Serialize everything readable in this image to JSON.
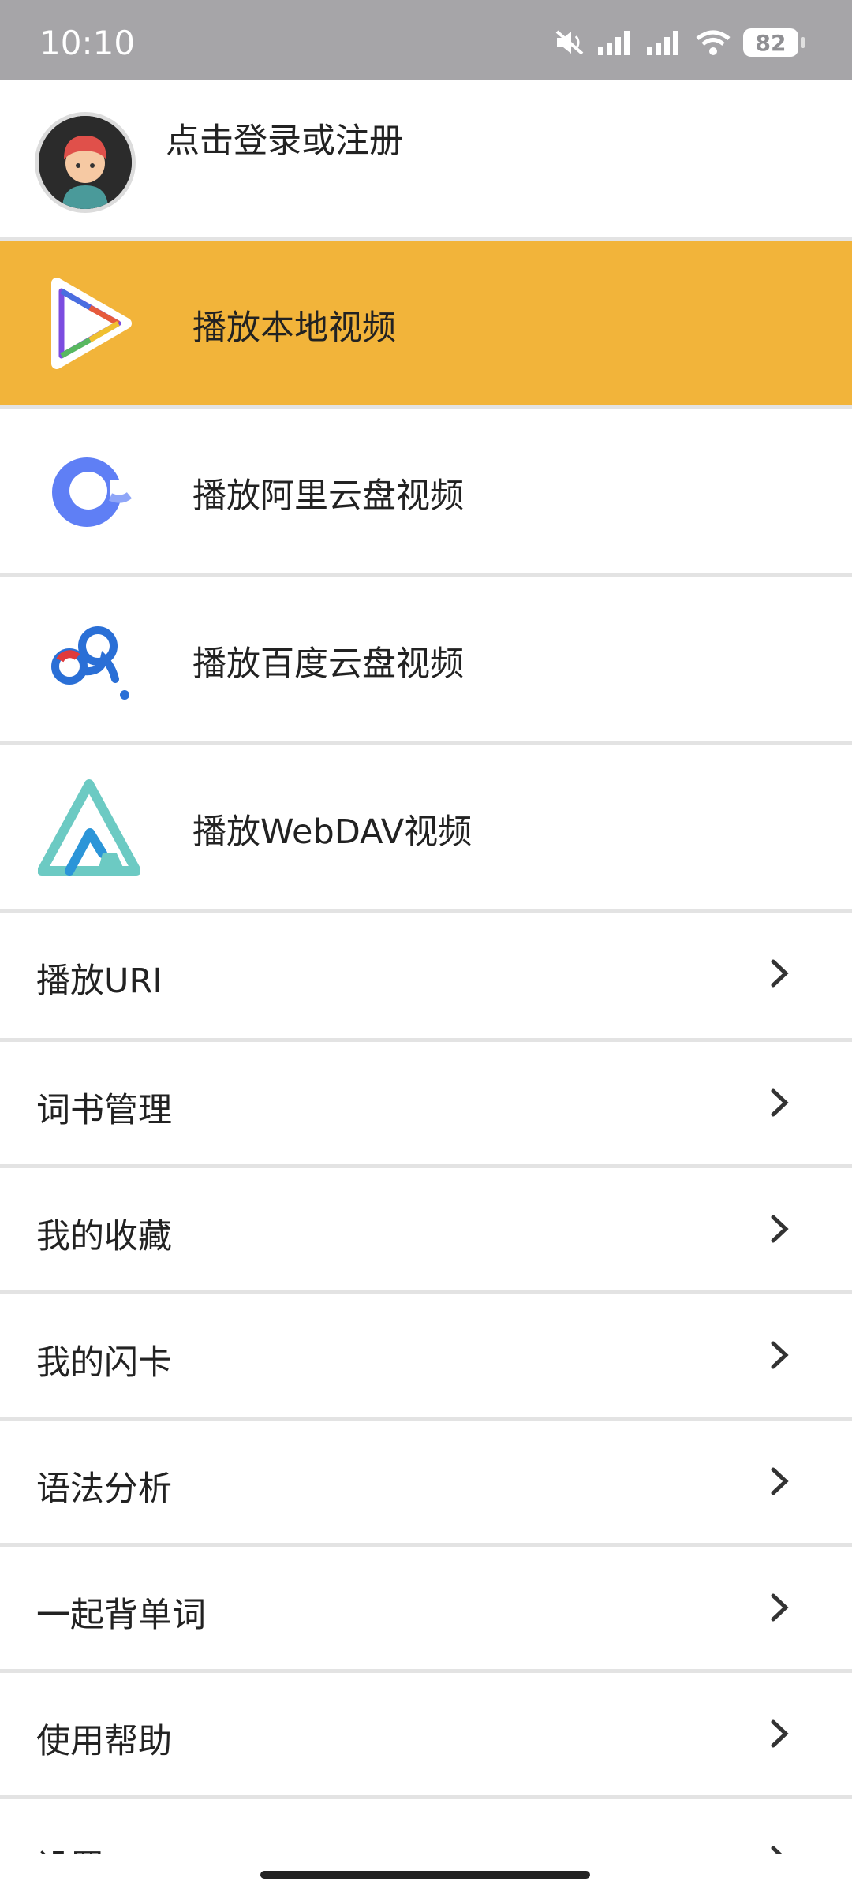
{
  "status_bar": {
    "time": "10:10",
    "battery": "82"
  },
  "profile": {
    "login_label": "点击登录或注册"
  },
  "media_sources": [
    {
      "label": "播放本地视频",
      "icon": "play-triangle-icon",
      "active": true
    },
    {
      "label": "播放阿里云盘视频",
      "icon": "aliyun-drive-icon",
      "active": false
    },
    {
      "label": "播放百度云盘视频",
      "icon": "baidu-netdisk-icon",
      "active": false
    },
    {
      "label": "播放WebDAV视频",
      "icon": "webdav-icon",
      "active": false
    }
  ],
  "menu": [
    {
      "label": "播放URI"
    },
    {
      "label": "词书管理"
    },
    {
      "label": "我的收藏"
    },
    {
      "label": "我的闪卡"
    },
    {
      "label": "语法分析"
    },
    {
      "label": "一起背单词"
    },
    {
      "label": "使用帮助"
    },
    {
      "label": "设置"
    }
  ],
  "colors": {
    "accent": "#f2b43a",
    "status_bar": "#a6a5a8",
    "divider": "#e3e3e3"
  }
}
